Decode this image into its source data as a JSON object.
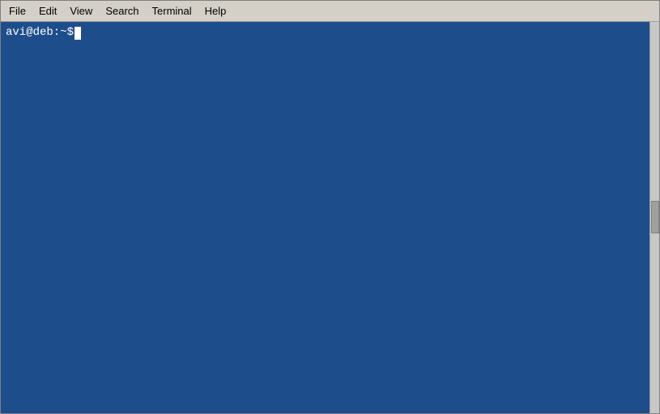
{
  "menubar": {
    "items": [
      {
        "id": "file",
        "label": "File"
      },
      {
        "id": "edit",
        "label": "Edit"
      },
      {
        "id": "view",
        "label": "View"
      },
      {
        "id": "search",
        "label": "Search"
      },
      {
        "id": "terminal",
        "label": "Terminal"
      },
      {
        "id": "help",
        "label": "Help"
      }
    ]
  },
  "terminal": {
    "prompt": "avi@deb:~$ ",
    "background_color": "#1e4d8c"
  }
}
